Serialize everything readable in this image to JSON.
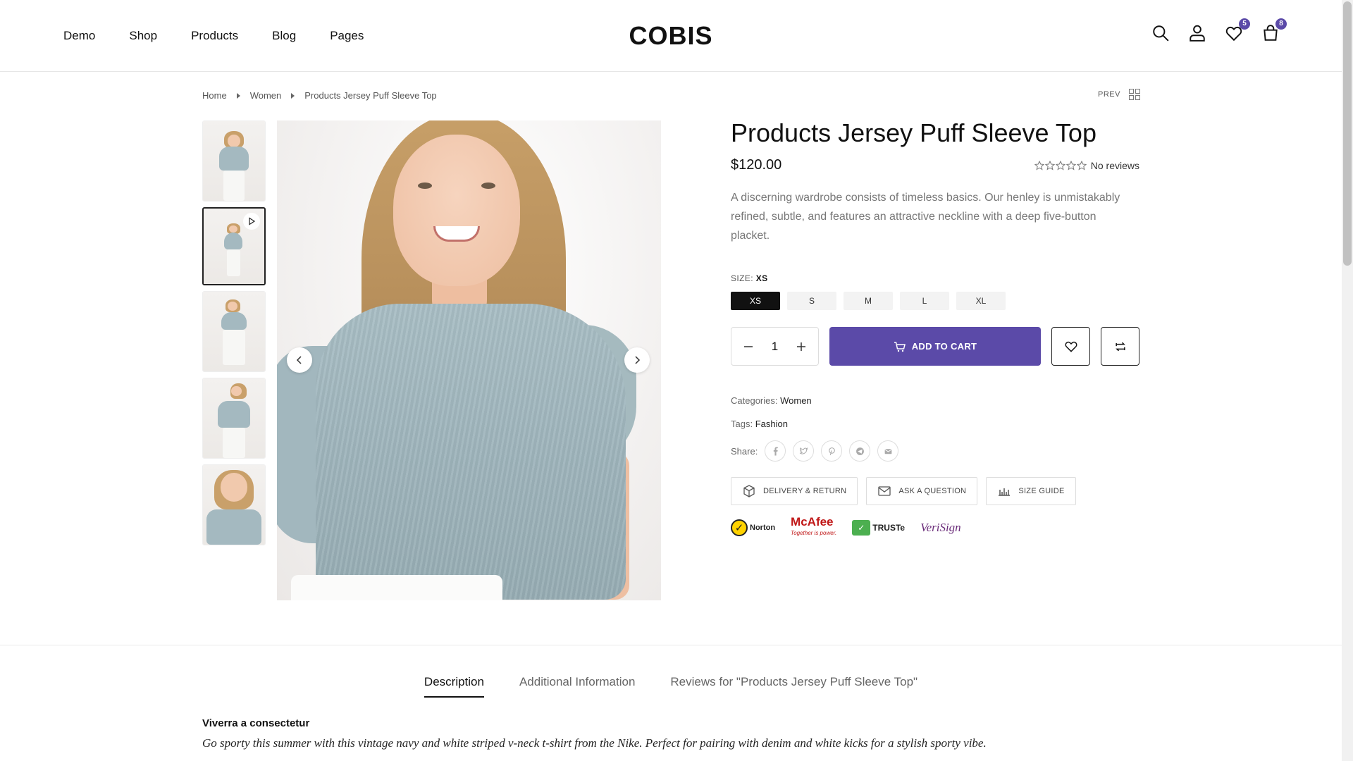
{
  "header": {
    "nav": [
      "Demo",
      "Shop",
      "Products",
      "Blog",
      "Pages"
    ],
    "logo": "COBIS",
    "wishlist_count": "5",
    "cart_count": "8",
    "accent_color": "#5b4aa8"
  },
  "breadcrumb": {
    "items": [
      "Home",
      "Women",
      "Products Jersey Puff Sleeve Top"
    ],
    "prev_label": "PREV"
  },
  "product": {
    "title": "Products Jersey Puff Sleeve Top",
    "price": "$120.00",
    "reviews_text": "No reviews",
    "rating": 0,
    "description": "A discerning wardrobe consists of timeless basics. Our henley is unmistakably refined, subtle, and features an attractive neckline with a deep five-button placket.",
    "size_label": "SIZE:",
    "size_selected": "XS",
    "sizes": [
      "XS",
      "S",
      "M",
      "L",
      "XL"
    ],
    "quantity": "1",
    "add_to_cart": "ADD TO CART",
    "categories_label": "Categories:",
    "category": "Women",
    "tags_label": "Tags:",
    "tag": "Fashion",
    "share_label": "Share:",
    "share_icons": [
      "facebook-icon",
      "twitter-icon",
      "pinterest-icon",
      "telegram-icon",
      "email-icon"
    ],
    "policy_buttons": [
      "DELIVERY & RETURN",
      "ASK A QUESTION",
      "SIZE GUIDE"
    ],
    "trust_badges": {
      "norton": "Norton",
      "mcafee": "McAfee",
      "mcafee_tagline": "Together is power.",
      "truste": "TRUSTe",
      "verisign": "VeriSign"
    }
  },
  "gallery": {
    "thumbnail_count": 5,
    "active_thumbnail": 2,
    "video_thumbnail": 2
  },
  "tabs": {
    "items": [
      "Description",
      "Additional Information",
      "Reviews for \"Products Jersey Puff Sleeve Top\""
    ],
    "active": 0,
    "heading": "Viverra a consectetur",
    "body": "Go sporty this summer with this vintage navy and white striped v-neck t-shirt from the Nike. Perfect for pairing with denim and white kicks for a stylish sporty vibe."
  }
}
